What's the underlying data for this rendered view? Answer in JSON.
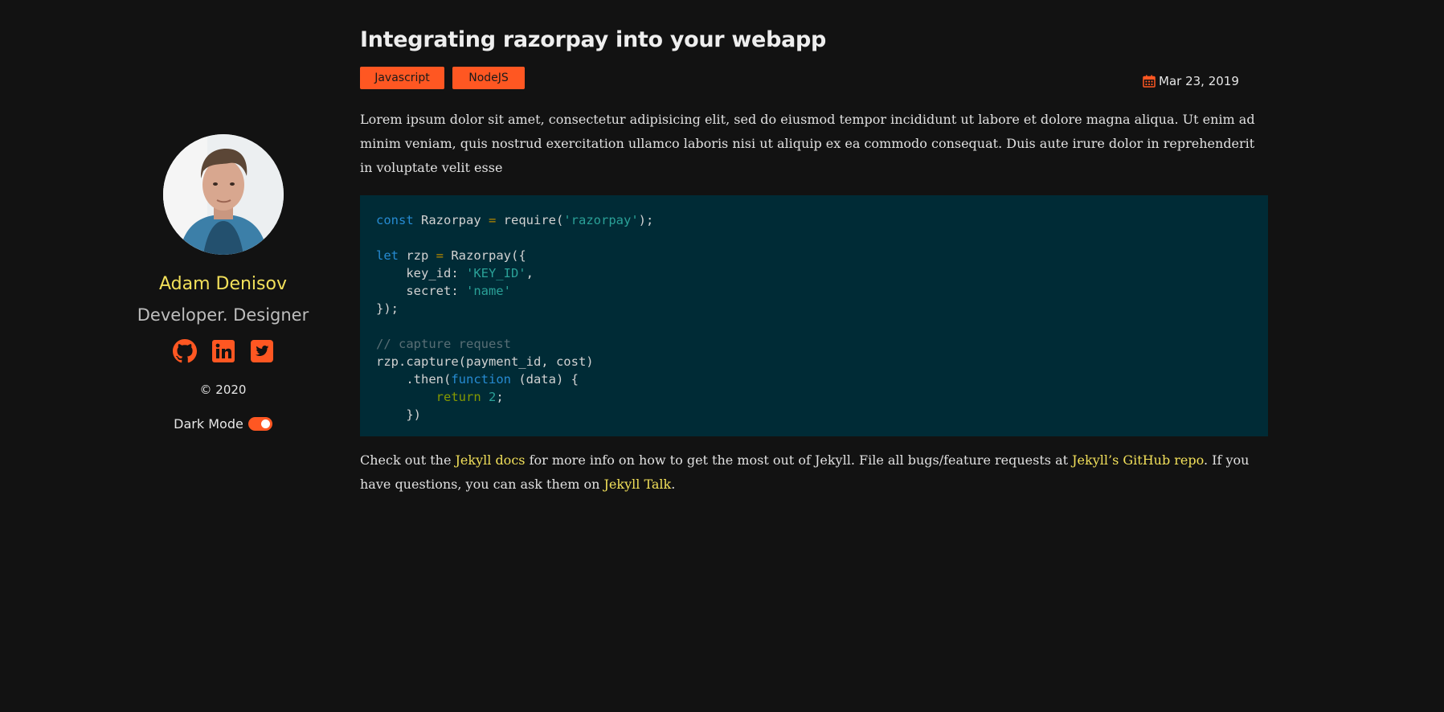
{
  "sidebar": {
    "author_name": "Adam Denisov",
    "tagline": "Developer. Designer",
    "social": [
      {
        "icon": "github-icon"
      },
      {
        "icon": "linkedin-icon"
      },
      {
        "icon": "twitter-icon"
      }
    ],
    "copyright": "© 2020",
    "dark_mode_label": "Dark Mode",
    "dark_mode_on": true
  },
  "post": {
    "title": "Integrating razorpay into your webapp",
    "tags": [
      "Javascript",
      "NodeJS"
    ],
    "date": "Mar 23, 2019",
    "intro": "Lorem ipsum dolor sit amet, consectetur adipisicing elit, sed do eiusmod tempor incididunt ut labore et dolore magna aliqua. Ut enim ad minim veniam, quis nostrud exercitation ullamco laboris nisi ut aliquip ex ea commodo consequat. Duis aute irure dolor in reprehenderit in voluptate velit esse",
    "code": {
      "l1_kw": "const",
      "l1_a": " Razorpay ",
      "l1_op": "=",
      "l1_b": " require(",
      "l1_str": "'razorpay'",
      "l1_c": ");",
      "l3_kw": "let",
      "l3_a": " rzp ",
      "l3_op": "=",
      "l3_b": " Razorpay({",
      "l4_a": "    key_id: ",
      "l4_str": "'KEY_ID'",
      "l4_b": ",",
      "l5_a": "    secret: ",
      "l5_str": "'name'",
      "l6": "});",
      "l8_cm": "// capture request",
      "l9": "rzp.capture(payment_id, cost)",
      "l10_a": "    .then(",
      "l10_kw": "function",
      "l10_b": " (data) {",
      "l11_indent": "        ",
      "l11_ret": "return",
      "l11_sp": " ",
      "l11_num": "2",
      "l11_b": ";",
      "l12": "    })"
    },
    "outro": {
      "t1": "Check out the ",
      "link1": "Jekyll docs",
      "t2": " for more info on how to get the most out of Jekyll. File all bugs/feature requests at ",
      "link2": "Jekyll’s GitHub repo",
      "t3": ". If you have questions, you can ask them on ",
      "link3": "Jekyll Talk",
      "t4": "."
    }
  },
  "colors": {
    "background": "#121212",
    "accent": "#ff5722",
    "link": "#f2e05a",
    "code_bg": "#002b36"
  }
}
